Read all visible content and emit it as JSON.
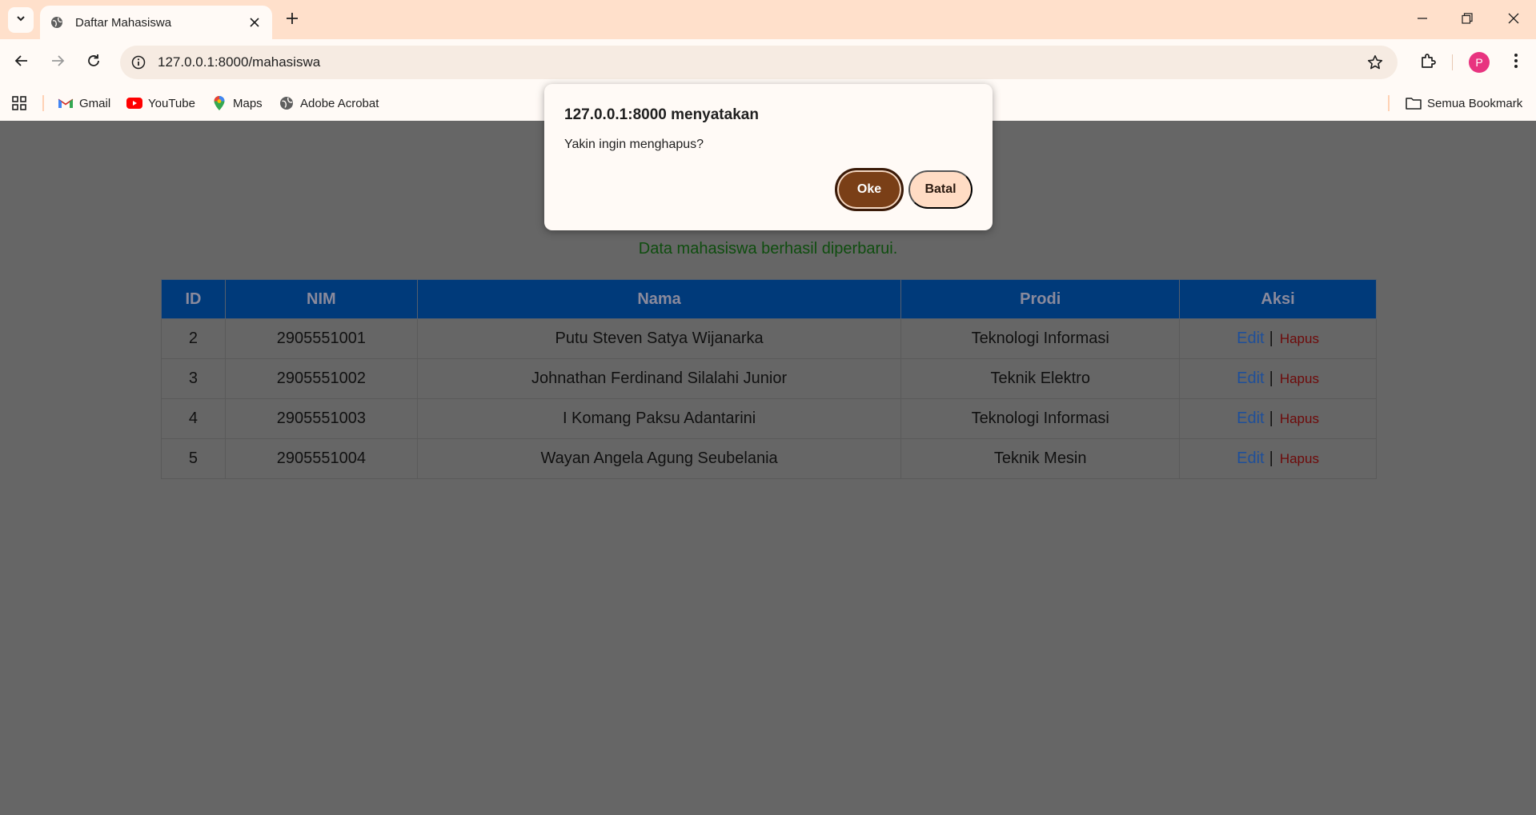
{
  "browser": {
    "tab_title": "Daftar Mahasiswa",
    "url": "127.0.0.1:8000/mahasiswa",
    "profile_initial": "P",
    "bookmarks": [
      {
        "label": "Gmail",
        "icon": "gmail-icon"
      },
      {
        "label": "YouTube",
        "icon": "youtube-icon"
      },
      {
        "label": "Maps",
        "icon": "maps-icon"
      },
      {
        "label": "Adobe Acrobat",
        "icon": "globe-icon"
      }
    ],
    "all_bookmarks_label": "Semua Bookmark"
  },
  "page": {
    "flash_message": "Data mahasiswa berhasil diperbarui.",
    "table": {
      "headers": [
        "ID",
        "NIM",
        "Nama",
        "Prodi",
        "Aksi"
      ],
      "rows": [
        {
          "id": "2",
          "nim": "2905551001",
          "nama": "Putu Steven Satya Wijanarka",
          "prodi": "Teknologi Informasi"
        },
        {
          "id": "3",
          "nim": "2905551002",
          "nama": "Johnathan Ferdinand Silalahi Junior",
          "prodi": "Teknik Elektro"
        },
        {
          "id": "4",
          "nim": "2905551003",
          "nama": "I Komang Paksu Adantarini",
          "prodi": "Teknologi Informasi"
        },
        {
          "id": "5",
          "nim": "2905551004",
          "nama": "Wayan Angela Agung Seubelania",
          "prodi": "Teknik Mesin"
        }
      ],
      "edit_label": "Edit",
      "separator": "|",
      "delete_label": "Hapus"
    }
  },
  "dialog": {
    "title": "127.0.0.1:8000 menyatakan",
    "message": "Yakin ingin menghapus?",
    "ok_label": "Oke",
    "cancel_label": "Batal"
  },
  "colors": {
    "tabstrip": "#ffe0cb",
    "table_header": "#003a7a",
    "flash_text": "#0f4d0f",
    "ok_button": "#7a3f17",
    "cancel_button": "#ffdcc4"
  }
}
